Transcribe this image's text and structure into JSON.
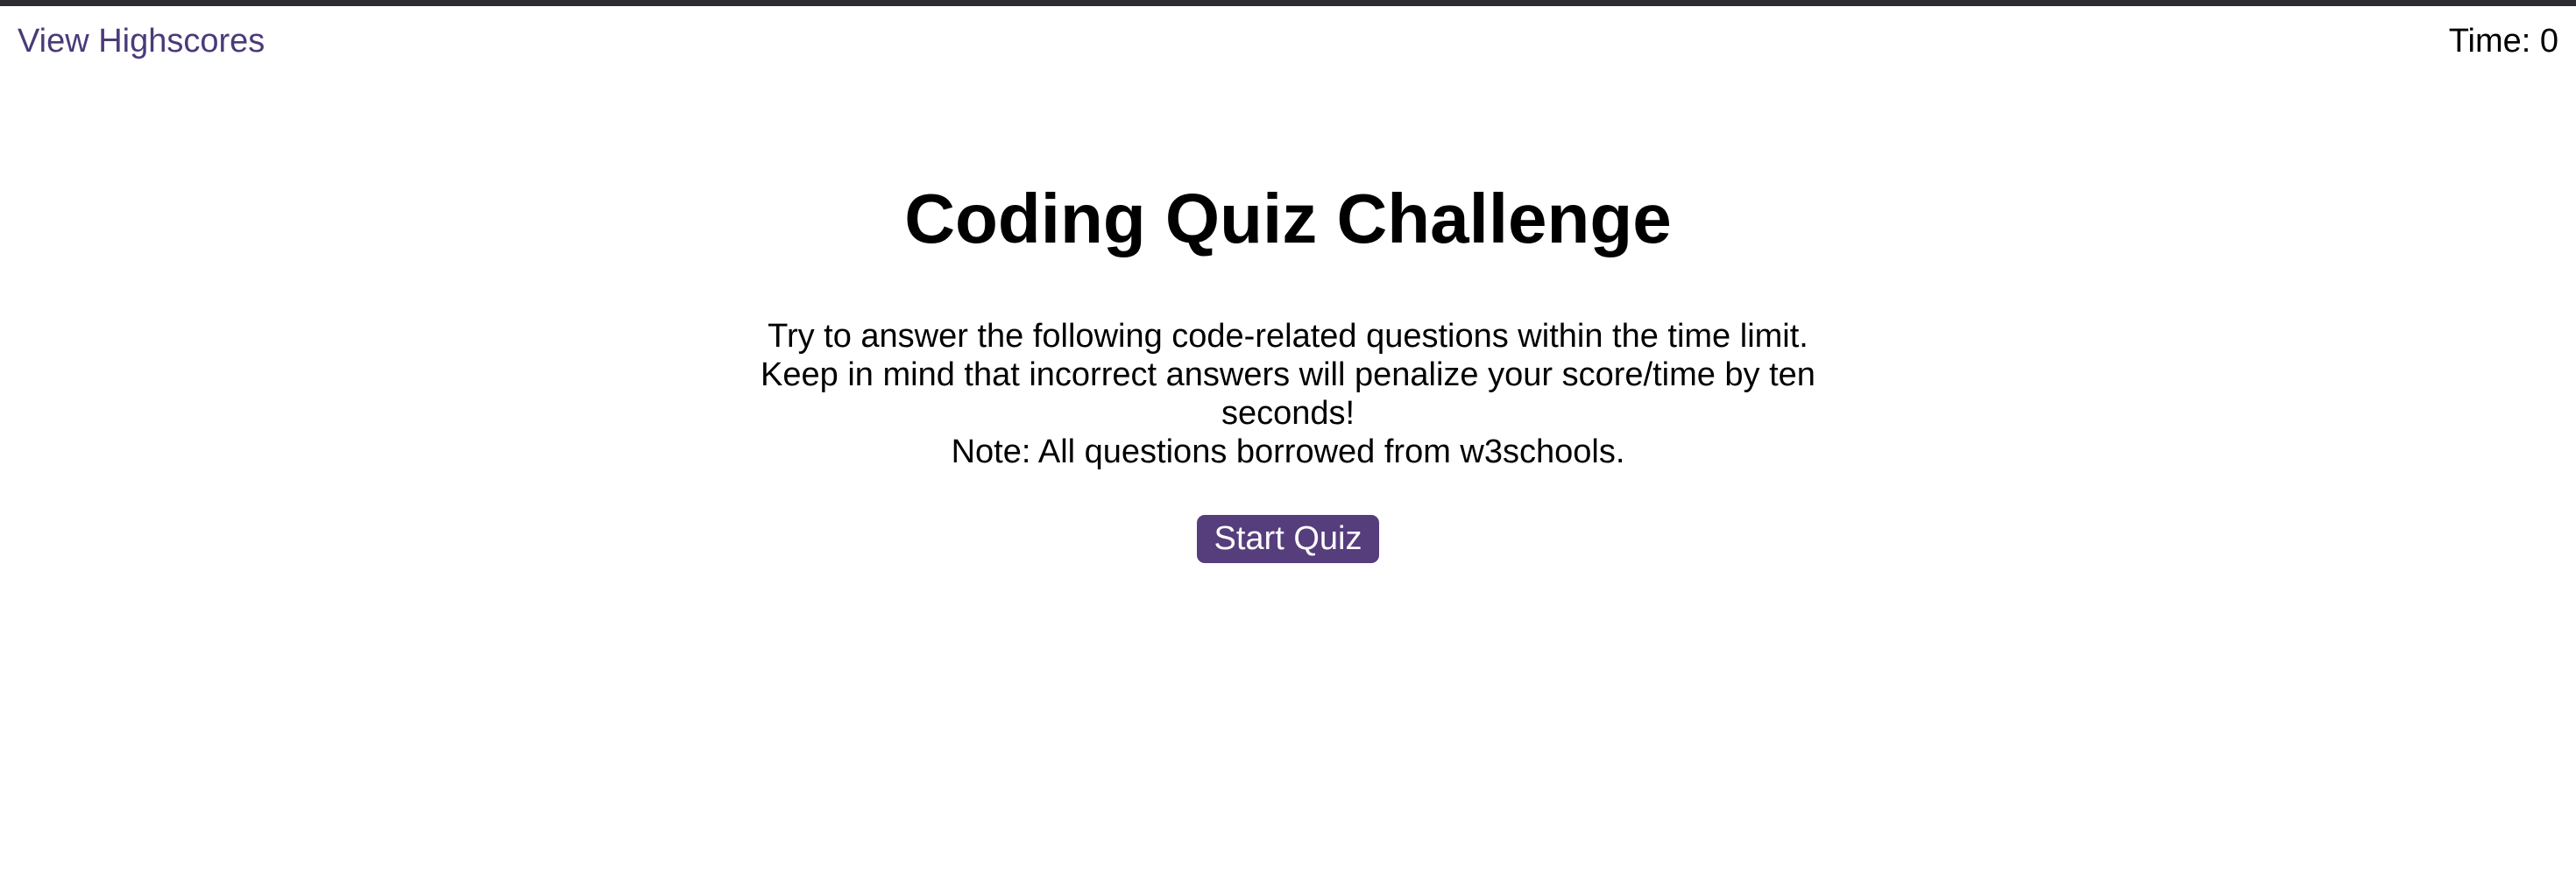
{
  "header": {
    "highscores_label": "View Highscores",
    "timer_label": "Time:",
    "timer_value": "0"
  },
  "main": {
    "title": "Coding Quiz Challenge",
    "intro": "Try to answer the following code-related questions within the time limit. Keep in mind that incorrect answers will penalize your score/time by ten seconds!",
    "note": "Note: All questions borrowed from w3schools.",
    "start_button_label": "Start Quiz"
  },
  "colors": {
    "link": "#4b3a79",
    "button_background": "#563d7c",
    "button_text": "#ffffff",
    "top_border": "#2b2d33"
  }
}
